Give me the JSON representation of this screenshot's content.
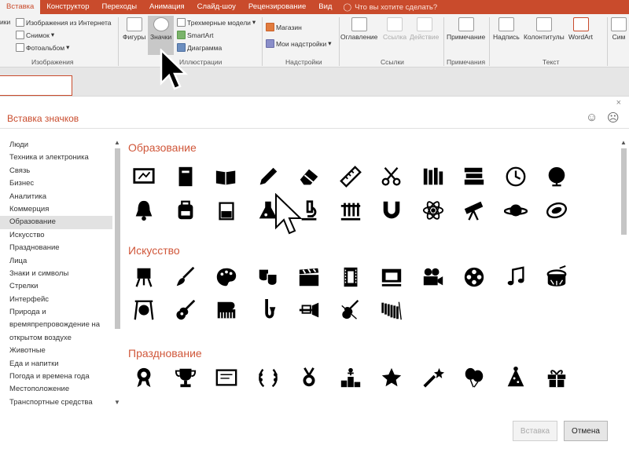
{
  "ribbon_tabs": [
    "Вставка",
    "Конструктор",
    "Переходы",
    "Анимация",
    "Слайд-шоу",
    "Рецензирование",
    "Вид"
  ],
  "tell_me": "Что вы хотите сделать?",
  "ribbon": {
    "left_cut": "ики",
    "online_pictures": "Изображения из Интернета",
    "screenshot": "Снимок",
    "photo_album": "Фотоальбом",
    "images_group": "Изображения",
    "shapes": "Фигуры",
    "icons": "Значки",
    "models_3d": "Трехмерные модели",
    "smartart": "SmartArt",
    "chart": "Диаграмма",
    "illustrations_group": "Иллюстрации",
    "store": "Магазин",
    "my_addins": "Мои надстройки",
    "addins_group": "Надстройки",
    "toc": "Оглавление",
    "link": "Ссылка",
    "action": "Действие",
    "links_group": "Ссылки",
    "comment": "Примечание",
    "comments_group": "Примечания",
    "textbox": "Надпись",
    "header_footer": "Колонтитулы",
    "wordart": "WordArt",
    "text_group": "Текст",
    "right_cut": "Сим"
  },
  "dialog": {
    "title": "Вставка значков",
    "close": "×",
    "smile": "☺",
    "frown": "☹",
    "insert": "Вставка",
    "cancel": "Отмена"
  },
  "categories": [
    "Люди",
    "Техника и электроника",
    "Связь",
    "Бизнес",
    "Аналитика",
    "Коммерция",
    "Образование",
    "Искусство",
    "Празднование",
    "Лица",
    "Знаки и символы",
    "Стрелки",
    "Интерфейс",
    "Природа и",
    "времяпрепровождение на",
    "открытом воздухе",
    "Животные",
    "Еда и напитки",
    "Погода и времена года",
    "Местоположение",
    "Транспортные средства"
  ],
  "selected_category": "Образование",
  "sections": [
    "Образование",
    "Искусство",
    "Празднование"
  ],
  "icons": {
    "education": [
      "blackboard-icon",
      "book-icon",
      "open-book-icon",
      "pencil-icon",
      "eraser-icon",
      "ruler-icon",
      "scissors-icon",
      "books-icon",
      "book-stack-icon",
      "clock-icon",
      "globe-icon",
      "bell-icon",
      "backpack-icon",
      "beaker-icon",
      "flask-icon",
      "microscope-icon",
      "test-tubes-icon",
      "magnet-icon",
      "atom-icon",
      "telescope-icon",
      "planet-icon",
      "galaxy-icon"
    ],
    "art": [
      "easel-icon",
      "paintbrush-icon",
      "palette-icon",
      "theater-masks-icon",
      "clapperboard-icon",
      "film-strip-icon",
      "theater-stage-icon",
      "movie-camera-icon",
      "film-reel-icon",
      "music-note-icon",
      "drum-icon",
      "gong-icon",
      "guitar-icon",
      "piano-icon",
      "saxophone-icon",
      "trumpet-icon",
      "violin-icon",
      "xylophone-icon"
    ],
    "celebration": [
      "ribbon-award-icon",
      "trophy-icon",
      "certificate-icon",
      "laurel-wreath-icon",
      "medal-icon",
      "podium-icon",
      "star-icon",
      "shooting-star-icon",
      "balloons-icon",
      "party-hat-icon",
      "gift-icon"
    ]
  }
}
